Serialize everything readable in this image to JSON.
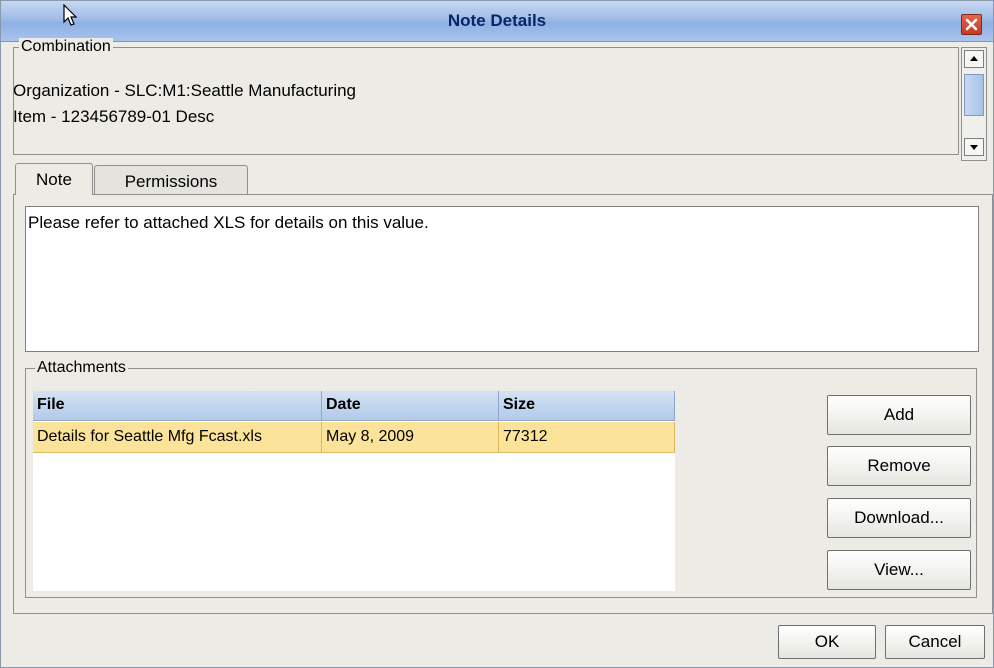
{
  "window": {
    "title": "Note Details"
  },
  "combination": {
    "legend": "Combination",
    "lines": [
      "Organization - SLC:M1:Seattle Manufacturing",
      "Item - 123456789-01 Desc"
    ]
  },
  "tabs": [
    {
      "label": "Note",
      "active": true
    },
    {
      "label": "Permissions",
      "active": false
    }
  ],
  "note": {
    "text": "Please refer to attached XLS for details on this value."
  },
  "attachments": {
    "legend": "Attachments",
    "columns": [
      "File",
      "Date",
      "Size"
    ],
    "rows": [
      {
        "file": "Details for Seattle Mfg Fcast.xls",
        "date": "May 8, 2009",
        "size": "77312",
        "selected": true
      }
    ],
    "buttons": {
      "add": "Add",
      "remove": "Remove",
      "download": "Download...",
      "view": "View..."
    }
  },
  "footer": {
    "ok": "OK",
    "cancel": "Cancel"
  },
  "colors": {
    "title_bar": "#9fbbe6",
    "selected_row": "#fce39a",
    "header": "#b3cae9",
    "close_button": "#d4502f"
  },
  "icons": [
    "cursor-icon",
    "close-icon",
    "scroll-up-icon",
    "scroll-down-icon"
  ]
}
